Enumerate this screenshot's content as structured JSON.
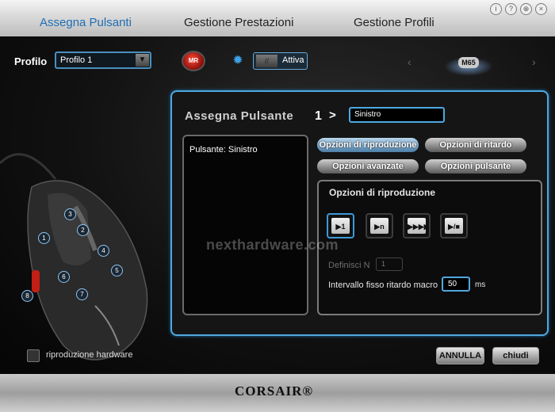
{
  "window": {
    "icons": [
      "info-icon",
      "help-icon",
      "globe-icon",
      "close-icon"
    ]
  },
  "tabs": [
    "Assegna Pulsanti",
    "Gestione Prestazioni",
    "Gestione Profili"
  ],
  "profile": {
    "label": "Profilo",
    "value": "Profilo 1"
  },
  "macro_record": {
    "label": "MR"
  },
  "lighting": {
    "toggle_knob": "//",
    "toggle_label": "Attiva"
  },
  "device": {
    "model": "M65"
  },
  "mouse_buttons": [
    "1",
    "2",
    "3",
    "4",
    "5",
    "6",
    "7",
    "8"
  ],
  "hardware_playback": {
    "label": "riproduzione hardware",
    "checked": false
  },
  "assign": {
    "title": "Assegna Pulsante",
    "button_number": "1",
    "arrow": ">",
    "name_value": "Sinistro",
    "list_text": "Pulsante: Sinistro"
  },
  "options": [
    {
      "label": "Opzioni di riproduzione",
      "selected": true
    },
    {
      "label": "Opzioni di ritardo",
      "selected": false
    },
    {
      "label": "Opzioni avanzate",
      "selected": false
    },
    {
      "label": "Opzioni pulsante",
      "selected": false
    }
  ],
  "playback": {
    "title": "Opzioni di riproduzione",
    "modes": [
      {
        "glyph": "▶1",
        "selected": true
      },
      {
        "glyph": "▶n",
        "selected": false
      },
      {
        "glyph": "▶▶▶▶",
        "selected": false
      },
      {
        "glyph": "▶/■",
        "selected": false
      }
    ],
    "define_label": "Definisci N",
    "define_value": "1",
    "interval_label": "Intervallo fisso ritardo macro",
    "interval_value": "50",
    "interval_unit": "ms"
  },
  "actions": {
    "cancel": "ANNULLA",
    "close": "chiudi"
  },
  "watermark": "nexthardware.com",
  "brand": "CORSAIR®",
  "colors": {
    "accent": "#4ea8e0",
    "tab_active": "#1f6fb4",
    "record": "#d9271a"
  }
}
